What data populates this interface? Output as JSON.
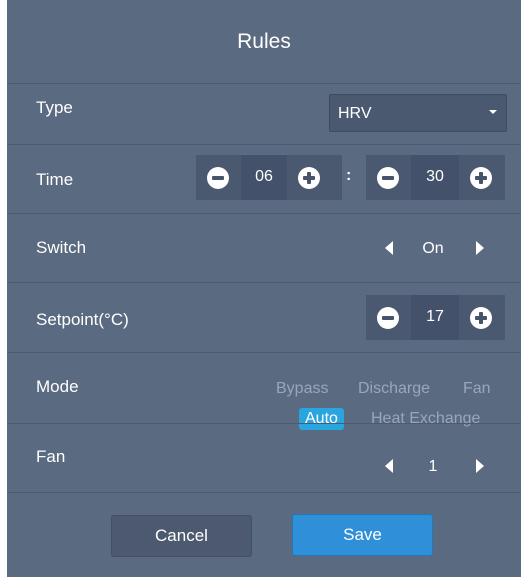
{
  "dialog": {
    "title": "Rules"
  },
  "type": {
    "label": "Type",
    "selected": "HRV"
  },
  "time": {
    "label": "Time",
    "hour": "06",
    "separator": ":",
    "minute": "30"
  },
  "switch": {
    "label": "Switch",
    "value": "On"
  },
  "setpoint": {
    "label": "Setpoint(°C)",
    "value": "17"
  },
  "mode": {
    "label": "Mode",
    "options": [
      "Bypass",
      "Discharge",
      "Fan",
      "Auto",
      "Heat Exchange"
    ],
    "selected": "Auto"
  },
  "fan": {
    "label": "Fan",
    "value": "1"
  },
  "buttons": {
    "cancel": "Cancel",
    "save": "Save"
  },
  "colors": {
    "panel_bg": "#5a6a81",
    "control_bg": "#4a5870",
    "accent": "#29a6e0",
    "save_button": "#2f8fd8",
    "inactive_text": "#9aa6b8"
  },
  "icons": [
    "minus-circle-icon",
    "plus-circle-icon",
    "triangle-left-icon",
    "triangle-right-icon",
    "caret-down-icon"
  ]
}
